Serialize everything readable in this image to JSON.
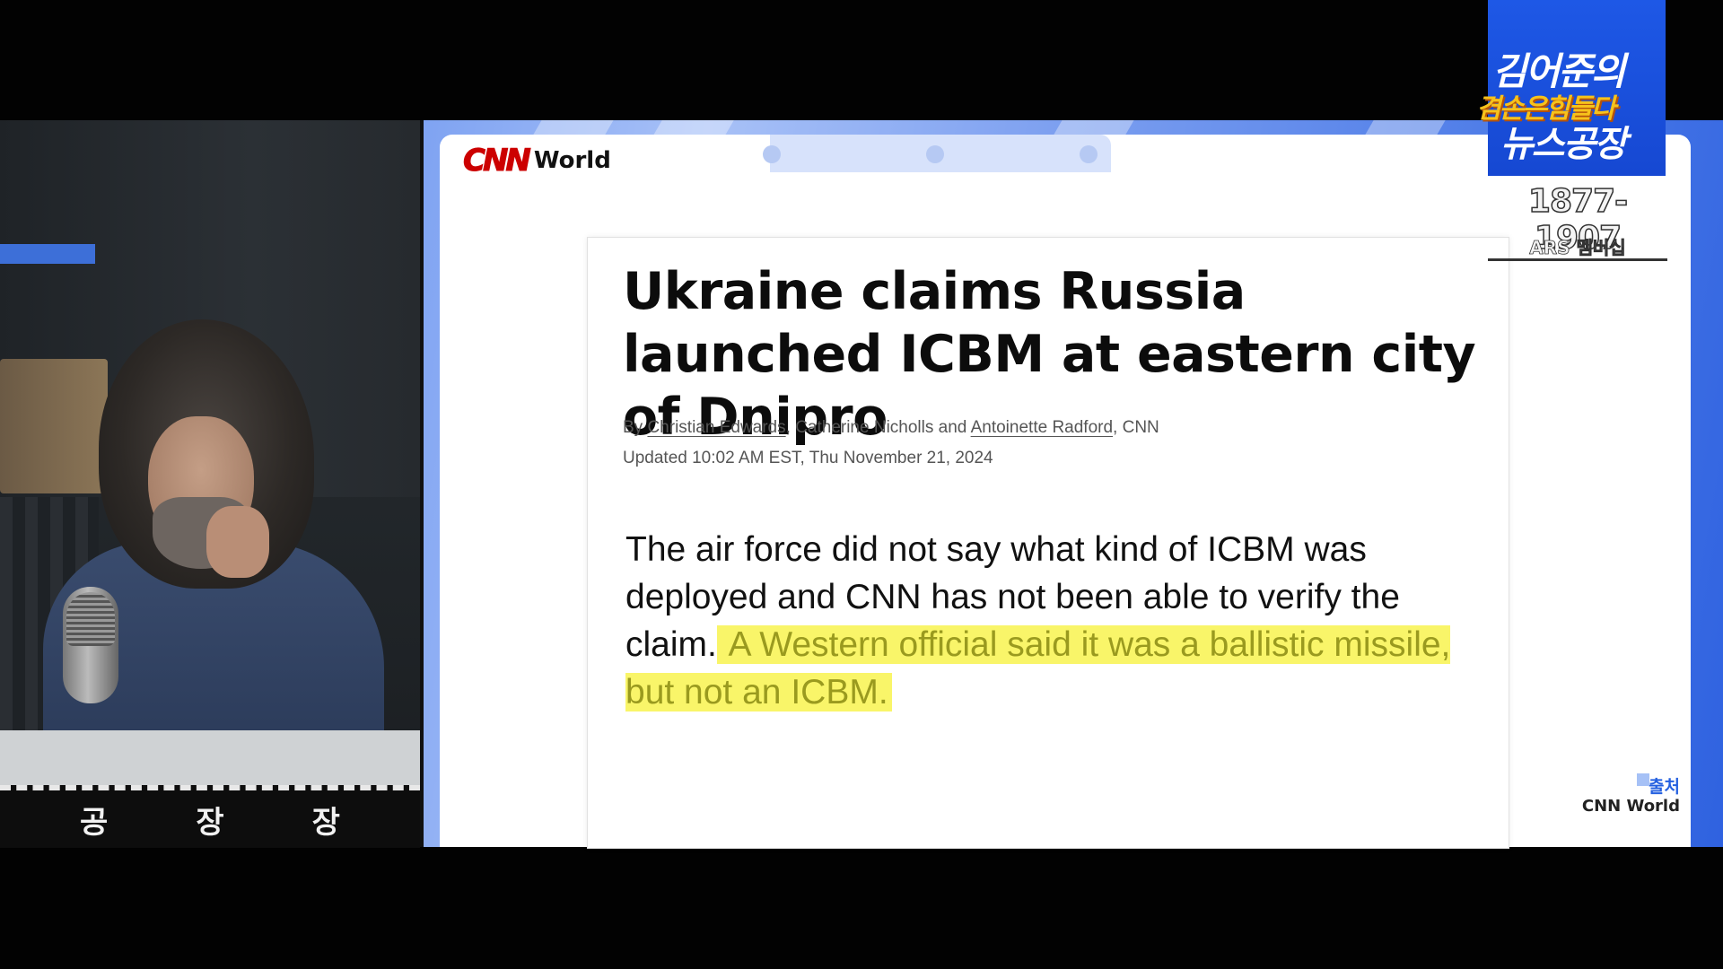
{
  "channel": {
    "title_line1": "김어준의",
    "title_line2": "겸손은힘들다",
    "title_line3": "뉴스공장",
    "phone": "1877-1907",
    "phone_label": "ARS 멤버십"
  },
  "studio": {
    "nameplate": [
      "공",
      "장",
      "장"
    ]
  },
  "article": {
    "outlet_mark": "CNN",
    "outlet_section": "World",
    "headline": "Ukraine claims Russia launched ICBM at eastern city of Dnipro",
    "byline_prefix": "By ",
    "author1": "Christian Edwards",
    "sep1": ", ",
    "author2": "Catherine Nicholls",
    "sep2": " and ",
    "author3": "Antoinette Radford",
    "byline_suffix": ", CNN",
    "updated": "Updated 10:02 AM EST, Thu November 21, 2024",
    "body_plain": "The air force did not say what kind of ICBM was deployed and CNN has not been able to verify the claim.",
    "body_highlight": " A Western official said it was a ballistic missile, but not an ICBM."
  },
  "source": {
    "label": "출처",
    "name": "CNN World"
  },
  "colors": {
    "brand_blue": "#1e58e6",
    "brand_yellow": "#f7c21b",
    "cnn_red": "#cc0000",
    "highlight": "#f9f569"
  }
}
